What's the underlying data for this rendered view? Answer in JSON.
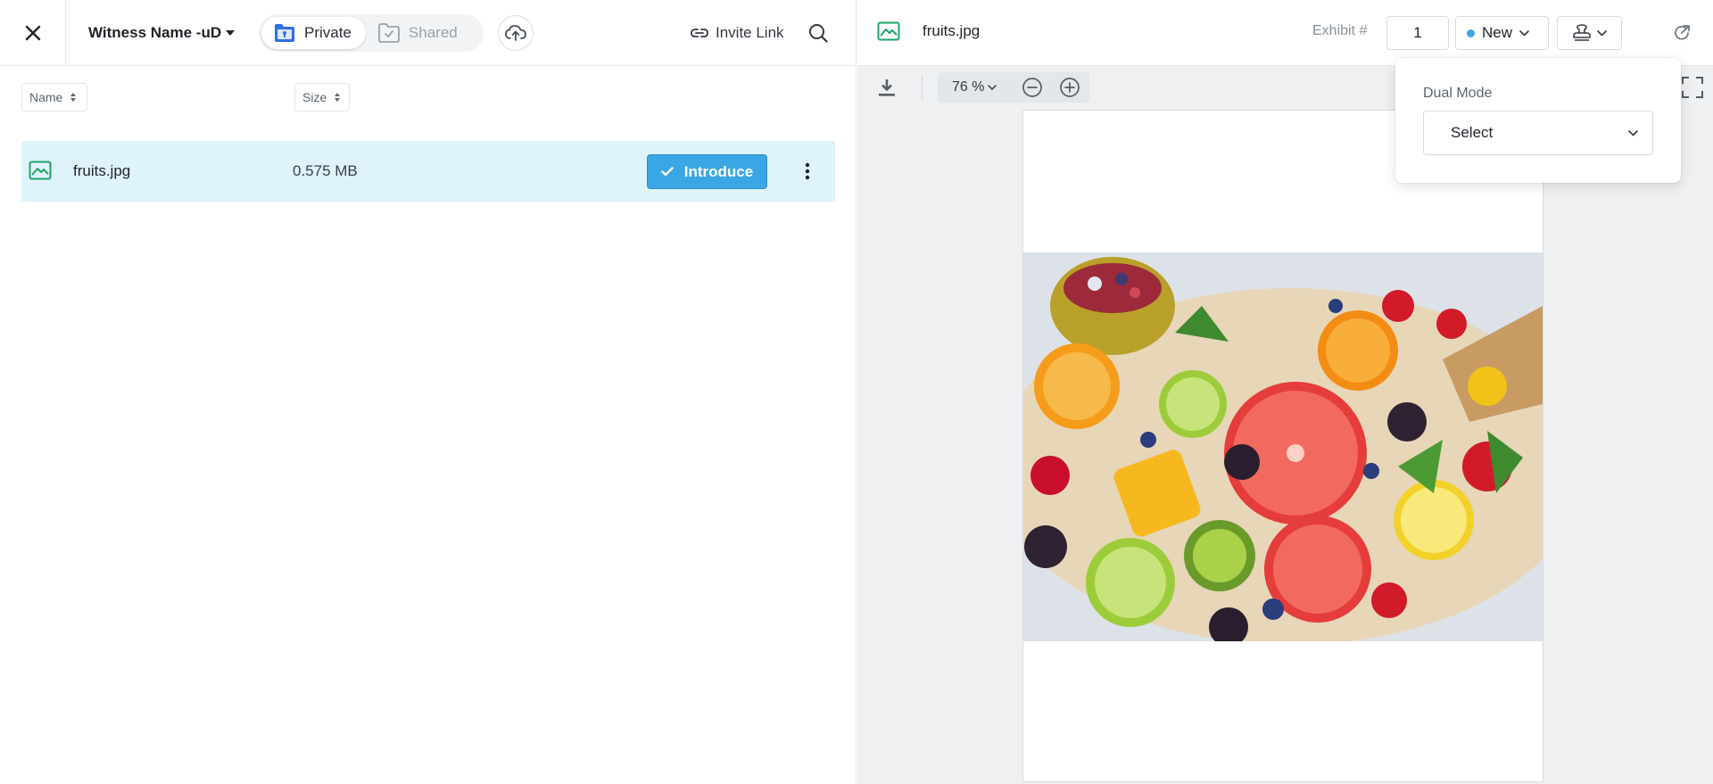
{
  "left_header": {
    "witness_name": "Witness Name -uD",
    "tabs": [
      {
        "label": "Private",
        "active": true
      },
      {
        "label": "Shared",
        "active": false
      }
    ],
    "invite_label": "Invite Link"
  },
  "table": {
    "columns": [
      "Name",
      "Size"
    ],
    "rows": [
      {
        "name": "fruits.jpg",
        "size": "0.575 MB",
        "action_label": "Introduce",
        "selected": true
      }
    ]
  },
  "viewer": {
    "filename": "fruits.jpg",
    "exhibit_label": "Exhibit #",
    "exhibit_value": "1",
    "status": "New",
    "status_color": "#3aa6e4",
    "zoom": "76 %"
  },
  "popover": {
    "label": "Dual Mode",
    "select_value": "Select"
  },
  "colors": {
    "accent": "#3aa6e4",
    "row_highlight": "#dff3fb",
    "image_icon": "#1fa36b",
    "private_icon": "#2f6fe8"
  }
}
